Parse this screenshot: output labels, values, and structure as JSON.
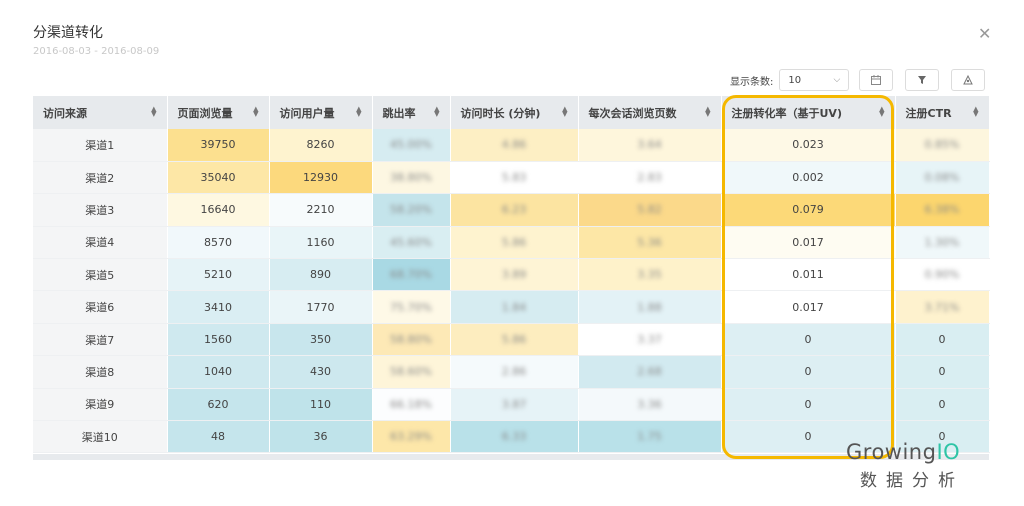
{
  "dialog": {
    "title": "分渠道转化",
    "date_range": "2016-08-03 - 2016-08-09",
    "close_icon": "close-icon"
  },
  "toolbar": {
    "page_size_label": "显示条数:",
    "page_size_value": "10",
    "buttons": [
      "calendar-icon",
      "filter-icon",
      "chart-icon"
    ]
  },
  "table": {
    "columns": [
      "访问来源",
      "页面浏览量",
      "访问用户量",
      "跳出率",
      "访问时长 (分钟)",
      "每次会话浏览页数",
      "注册转化率（基于UV)",
      "注册CTR"
    ],
    "rows": [
      {
        "source": "渠道1",
        "pv": "39750",
        "uv": "8260",
        "bounce": "45.00%",
        "duration": "4.86",
        "pages": "3.64",
        "conv": "0.023",
        "ctr": "0.85%"
      },
      {
        "source": "渠道2",
        "pv": "35040",
        "uv": "12930",
        "bounce": "38.80%",
        "duration": "5.83",
        "pages": "2.83",
        "conv": "0.002",
        "ctr": "0.08%"
      },
      {
        "source": "渠道3",
        "pv": "16640",
        "uv": "2210",
        "bounce": "58.20%",
        "duration": "6.23",
        "pages": "5.82",
        "conv": "0.079",
        "ctr": "6.38%"
      },
      {
        "source": "渠道4",
        "pv": "8570",
        "uv": "1160",
        "bounce": "45.60%",
        "duration": "5.86",
        "pages": "5.36",
        "conv": "0.017",
        "ctr": "1.30%"
      },
      {
        "source": "渠道5",
        "pv": "5210",
        "uv": "890",
        "bounce": "68.70%",
        "duration": "3.89",
        "pages": "3.35",
        "conv": "0.011",
        "ctr": "0.90%"
      },
      {
        "source": "渠道6",
        "pv": "3410",
        "uv": "1770",
        "bounce": "75.70%",
        "duration": "1.84",
        "pages": "1.88",
        "conv": "0.017",
        "ctr": "3.71%"
      },
      {
        "source": "渠道7",
        "pv": "1560",
        "uv": "350",
        "bounce": "58.80%",
        "duration": "5.86",
        "pages": "3.37",
        "conv": "0",
        "ctr": "0"
      },
      {
        "source": "渠道8",
        "pv": "1040",
        "uv": "430",
        "bounce": "58.60%",
        "duration": "2.86",
        "pages": "2.68",
        "conv": "0",
        "ctr": "0"
      },
      {
        "source": "渠道9",
        "pv": "620",
        "uv": "110",
        "bounce": "66.18%",
        "duration": "3.87",
        "pages": "3.36",
        "conv": "0",
        "ctr": "0"
      },
      {
        "source": "渠道10",
        "pv": "48",
        "uv": "36",
        "bounce": "63.29%",
        "duration": "6.33",
        "pages": "1.75",
        "conv": "0",
        "ctr": "0"
      }
    ],
    "heat_colors": {
      "pv": [
        "#fce08f",
        "#fde7a6",
        "#fef8e1",
        "#f1f8fb",
        "#e6f3f7",
        "#daeef3",
        "#cfe9ef",
        "#cfe9ef",
        "#c5e5ec",
        "#c5e5ec"
      ],
      "uv": [
        "#fef3cf",
        "#fcd97d",
        "#f7fbfc",
        "#e9f5f8",
        "#d7edf2",
        "#eaf5f8",
        "#c8e6ed",
        "#cde8ee",
        "#bfe3ea",
        "#bfe3ea"
      ],
      "bounce": [
        "#d6ecf1",
        "#fdf7e2",
        "#c4e4eb",
        "#d9eef2",
        "#a9d9e4",
        "#fef9e7",
        "#fde9b6",
        "#fef5d9",
        "#fcfdfe",
        "#fde7a9"
      ],
      "duration": [
        "#fdefc4",
        "#ffffff",
        "#fce4a1",
        "#fef3cf",
        "#fef4d5",
        "#d6ecf1",
        "#fdedbf",
        "#f5fafc",
        "#e6f3f7",
        "#b9e1e9"
      ],
      "pages": [
        "#fef6dc",
        "#ffffff",
        "#fbd98a",
        "#fde7a6",
        "#fef2ca",
        "#e3f2f6",
        "#ffffff",
        "#d2eaf0",
        "#f4f9fb",
        "#b9e1e9"
      ],
      "conv": [
        "#fef9e6",
        "#f0f8fa",
        "#fcd978",
        "#fefcf2",
        "#ffffff",
        "#ffffff",
        "#ddeff3",
        "#ddeff3",
        "#ddeff3",
        "#ddeff3"
      ],
      "ctr": [
        "#fdf6de",
        "#e7f4f7",
        "#fcd66e",
        "#f0f8fa",
        "#ffffff",
        "#fef2ce",
        "#d9eef2",
        "#d9eef2",
        "#d9eef2",
        "#d9eef2"
      ]
    }
  },
  "brand": {
    "logo_text_main": "Growing",
    "logo_text_accent": "IO",
    "logo_subtitle": "数据分析",
    "highlight_color": "#f5b800"
  }
}
